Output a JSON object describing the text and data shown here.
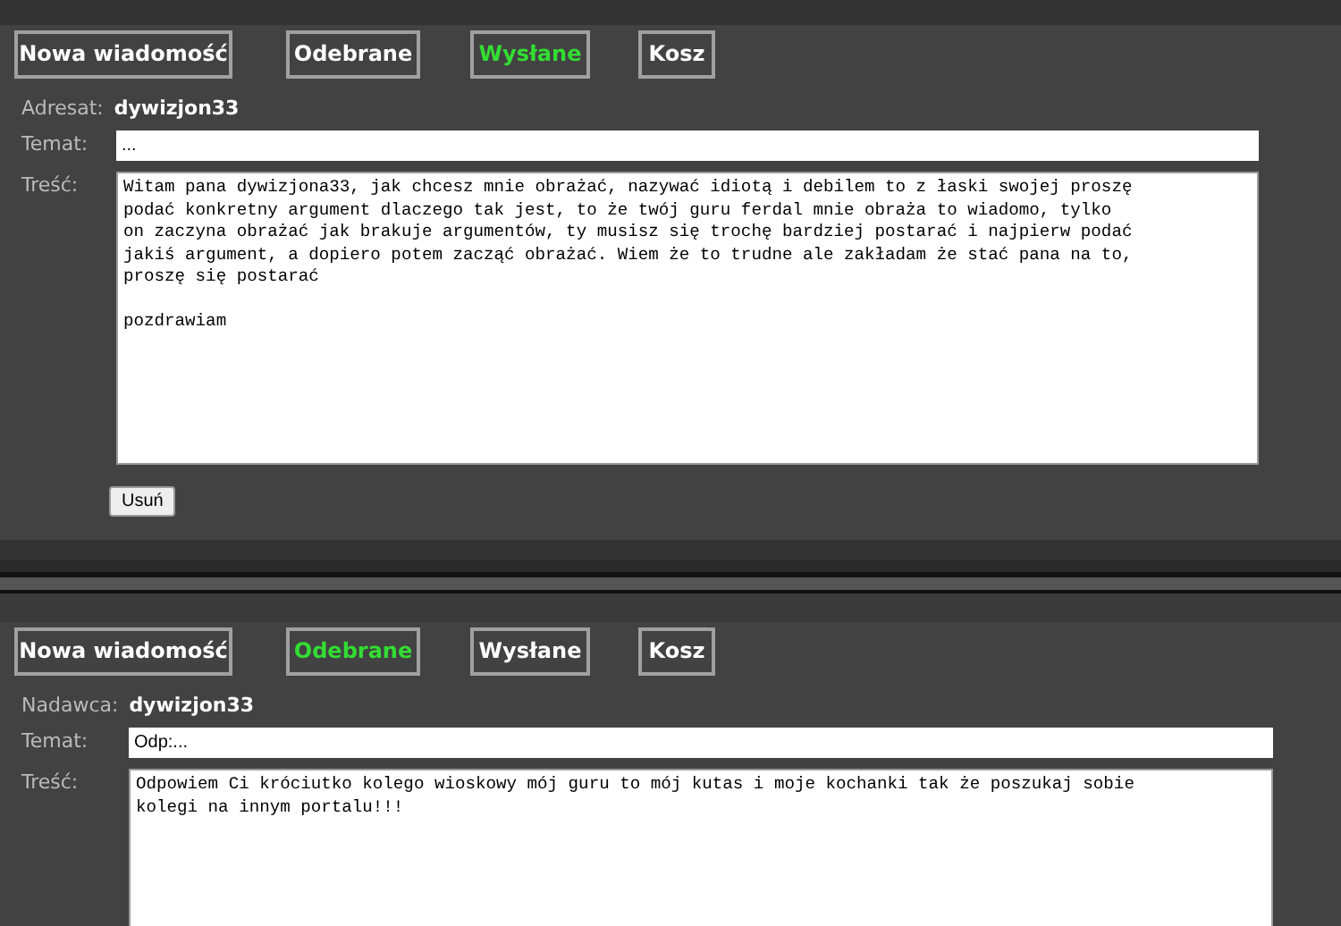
{
  "panels": [
    {
      "tabs": [
        {
          "label": "Nowa wiadomość",
          "selected": false
        },
        {
          "label": "Odebrane",
          "selected": false
        },
        {
          "label": "Wysłane",
          "selected": true
        },
        {
          "label": "Kosz",
          "selected": false
        }
      ],
      "person": {
        "label": "Adresat:",
        "value": "dywizjon33"
      },
      "subject": {
        "label": "Temat:",
        "value": "..."
      },
      "body": {
        "label": "Treść:",
        "value": "Witam pana dywizjona33, jak chcesz mnie obrażać, nazywać idiotą i debilem to z łaski swojej proszę\npodać konkretny argument dlaczego tak jest, to że twój guru ferdal mnie obraża to wiadomo, tylko\non zaczyna obrażać jak brakuje argumentów, ty musisz się trochę bardziej postarać i najpierw podać\njakiś argument, a dopiero potem zacząć obrażać. Wiem że to trudne ale zakładam że stać pana na to,\nproszę się postarać\n\npozdrawiam"
      },
      "button": "Usuń"
    },
    {
      "tabs": [
        {
          "label": "Nowa wiadomość",
          "selected": false
        },
        {
          "label": "Odebrane",
          "selected": true
        },
        {
          "label": "Wysłane",
          "selected": false
        },
        {
          "label": "Kosz",
          "selected": false
        }
      ],
      "person": {
        "label": "Nadawca:",
        "value": "dywizjon33"
      },
      "subject": {
        "label": "Temat:",
        "value": "Odp:..."
      },
      "body": {
        "label": "Treść:",
        "value": "Odpowiem Ci króciutko kolego wioskowy mój guru to mój kutas i moje kochanki tak że poszukaj sobie\nkolegi na innym portalu!!!"
      }
    }
  ]
}
